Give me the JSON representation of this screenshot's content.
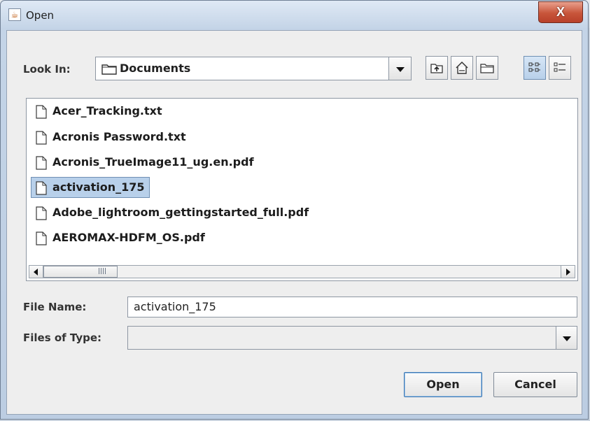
{
  "window": {
    "title": "Open",
    "close_symbol": "X"
  },
  "toolbar": {
    "look_in_label": "Look In:",
    "look_in_value": "Documents",
    "buttons": [
      {
        "name": "up-one-level-icon"
      },
      {
        "name": "home-icon"
      },
      {
        "name": "new-folder-icon"
      },
      {
        "name": "list-view-icon"
      },
      {
        "name": "details-view-icon"
      }
    ]
  },
  "files": [
    {
      "name": "Acer_Tracking.txt",
      "selected": false
    },
    {
      "name": "Acronis Password.txt",
      "selected": false
    },
    {
      "name": "Acronis_TrueImage11_ug.en.pdf",
      "selected": false
    },
    {
      "name": "activation_175",
      "selected": true
    },
    {
      "name": "Adobe_lightroom_gettingstarted_full.pdf",
      "selected": false
    },
    {
      "name": "AEROMAX-HDFM_OS.pdf",
      "selected": false
    }
  ],
  "form": {
    "file_name_label": "File Name:",
    "file_name_value": "activation_175",
    "files_of_type_label": "Files of Type:",
    "files_of_type_value": ""
  },
  "buttons": {
    "open": "Open",
    "cancel": "Cancel"
  }
}
